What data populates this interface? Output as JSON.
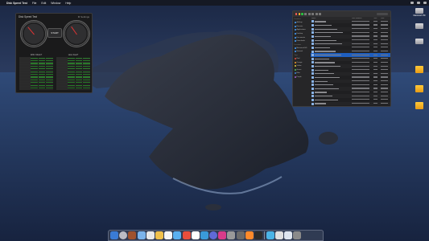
{
  "menubar": {
    "app_name": "Disk Speed Test",
    "menus": [
      "File",
      "Edit",
      "Window",
      "Help"
    ]
  },
  "disk_speed_test": {
    "title": "Disk Speed Test",
    "settings_label": "⚙ Settings",
    "write_gauge_value": "",
    "read_gauge_value": "",
    "start_label": "START",
    "write_table_title": "Will it Work?",
    "read_table_title": "How Fast?"
  },
  "finder": {
    "columns": {
      "name": "Name",
      "date": "Date Modified",
      "size": "Size",
      "kind": "Kind"
    },
    "sidebar": {
      "favorites_heading": "Favorites",
      "items": [
        "AirDrop",
        "Recents",
        "Applications",
        "Desktop",
        "Documents",
        "Downloads"
      ],
      "locations_heading": "Locations",
      "locations": [
        "Macintosh HD",
        "Network"
      ],
      "tags_heading": "Tags",
      "tags": [
        "Red",
        "Orange",
        "Yellow",
        "Green",
        "Blue",
        "Purple"
      ]
    },
    "rows_count_hint": "",
    "selected_index": 9
  },
  "desktop_icons": [
    {
      "label": "Macintosh HD",
      "type": "drive"
    },
    {
      "label": "",
      "type": "drive"
    },
    {
      "label": "",
      "type": "drive"
    },
    {
      "label": "",
      "type": "folder"
    },
    {
      "label": "",
      "type": "folder"
    },
    {
      "label": "",
      "type": "folder"
    }
  ],
  "dock_colors": [
    "#3a7bd5",
    "#bcbcc4",
    "#a0522d",
    "#7bb3ea",
    "#e8e8e8",
    "#f0c04a",
    "#f5f5f5",
    "#5ab0f0",
    "#e94e3c",
    "#ffffff",
    "#3a9ad9",
    "#5f6ad8",
    "#d83b8a",
    "#999999",
    "#6a6a6a",
    "#ff8a2a",
    "#2c2c2c",
    "#4bb4e6",
    "#e0e0e0",
    "#dfe6f0",
    "#8a8a8a"
  ],
  "colors": {
    "accent": "#1f5fbf",
    "ok_green": "#2a7a2a"
  }
}
